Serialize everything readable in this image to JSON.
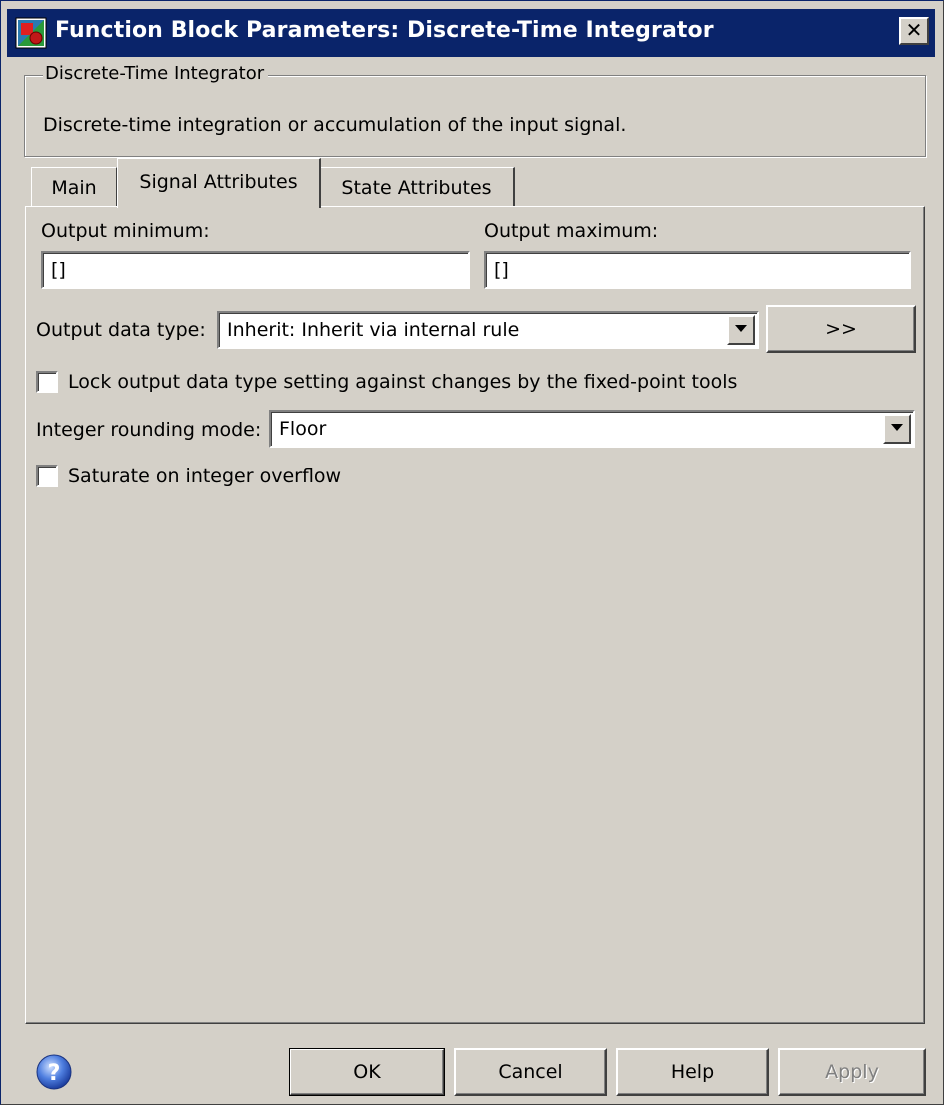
{
  "window": {
    "title": "Function Block Parameters: Discrete-Time Integrator",
    "close_glyph": "✕"
  },
  "description": {
    "group_title": "Discrete-Time Integrator",
    "text": "Discrete-time integration or accumulation of the input signal."
  },
  "tabs": [
    {
      "label": "Main",
      "active": false
    },
    {
      "label": "Signal Attributes",
      "active": true
    },
    {
      "label": "State Attributes",
      "active": false
    }
  ],
  "signal_attributes": {
    "output_minimum": {
      "label": "Output minimum:",
      "value": "[]"
    },
    "output_maximum": {
      "label": "Output maximum:",
      "value": "[]"
    },
    "output_data_type": {
      "label": "Output data type:",
      "value": "Inherit: Inherit via internal rule",
      "assistant_button": ">>"
    },
    "lock_output": {
      "label": "Lock output data type setting against changes by the fixed-point tools",
      "checked": false
    },
    "rounding_mode": {
      "label": "Integer rounding mode:",
      "value": "Floor"
    },
    "saturate": {
      "label": "Saturate on integer overflow",
      "checked": false
    }
  },
  "buttons": {
    "ok": "OK",
    "cancel": "Cancel",
    "help": "Help",
    "apply": "Apply"
  },
  "colors": {
    "titlebar": "#0a246a",
    "dialog_bg": "#d4d0c8",
    "field_bg": "#ffffff",
    "disabled_text": "#808080"
  },
  "icons": {
    "app": "simulink-block-icon",
    "help": "question-mark-help-icon",
    "dropdown": "chevron-down-icon"
  }
}
